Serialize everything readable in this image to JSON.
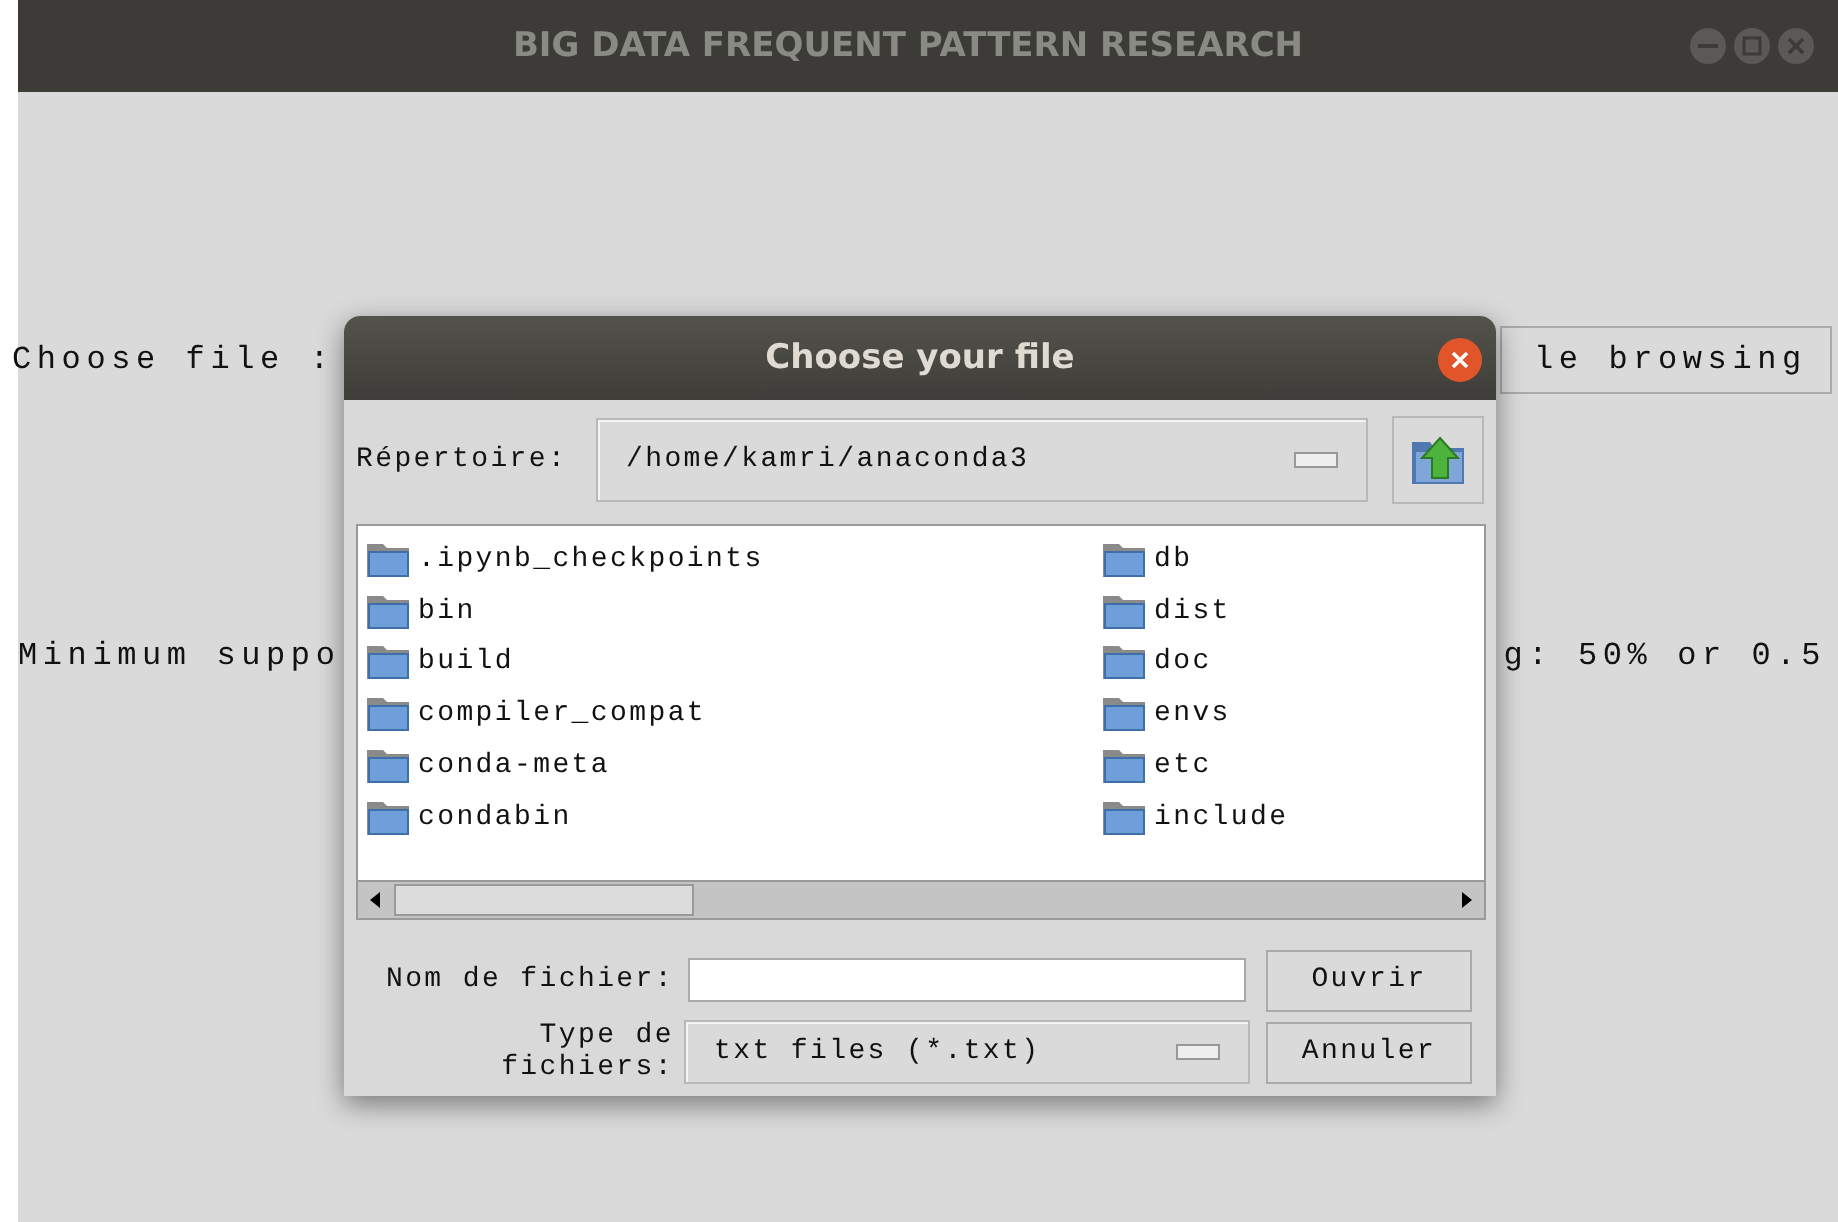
{
  "window": {
    "title": "BIG DATA FREQUENT PATTERN RESEARCH"
  },
  "main": {
    "choose_label": "Choose file :",
    "browse_button": "le browsing",
    "support_label": "Minimum suppo",
    "support_hint": "g: 50% or 0.5"
  },
  "dialog": {
    "title": "Choose your file",
    "directory_label": "Répertoire:",
    "directory": "/home/kamri/anaconda3",
    "items": [
      {
        "name": ".ipynb_checkpoints"
      },
      {
        "name": "bin"
      },
      {
        "name": "build"
      },
      {
        "name": "compiler_compat"
      },
      {
        "name": "conda-meta"
      },
      {
        "name": "condabin"
      },
      {
        "name": "db"
      },
      {
        "name": "dist"
      },
      {
        "name": "doc"
      },
      {
        "name": "envs"
      },
      {
        "name": "etc"
      },
      {
        "name": "include"
      }
    ],
    "filename_label": "Nom de fichier:",
    "filetype_label": "Type de fichiers:",
    "filetype": "txt files (*.txt)",
    "buttons": [
      "Ouvrir",
      "Annuler"
    ]
  }
}
